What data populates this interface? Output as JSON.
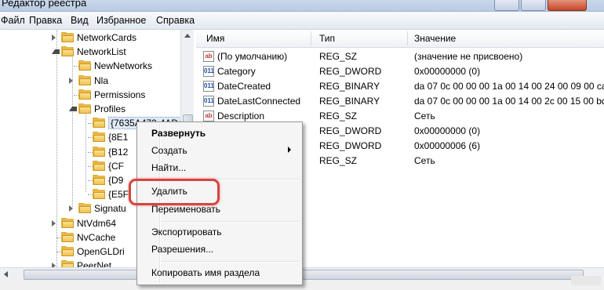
{
  "window": {
    "title": "Редактор реестра"
  },
  "menu": [
    "Файл",
    "Правка",
    "Вид",
    "Избранное",
    "Справка"
  ],
  "tree": [
    {
      "label": "NetworkCards",
      "expander": "closed",
      "depth": 0
    },
    {
      "label": "NetworkList",
      "expander": "open",
      "depth": 0
    },
    {
      "label": "NewNetworks",
      "expander": "none",
      "depth": 1
    },
    {
      "label": "Nla",
      "expander": "closed",
      "depth": 1
    },
    {
      "label": "Permissions",
      "expander": "none",
      "depth": 1
    },
    {
      "label": "Profiles",
      "expander": "open",
      "depth": 1
    },
    {
      "label": "{7635A472-4AD4",
      "expander": "none",
      "depth": 2,
      "selected": true
    },
    {
      "label": "{8E1",
      "expander": "none",
      "depth": 2
    },
    {
      "label": "{B12",
      "expander": "none",
      "depth": 2
    },
    {
      "label": "{CF",
      "expander": "none",
      "depth": 2
    },
    {
      "label": "{D9",
      "expander": "none",
      "depth": 2
    },
    {
      "label": "{E5F",
      "expander": "none",
      "depth": 2
    },
    {
      "label": "Signatu",
      "expander": "closed",
      "depth": 1
    },
    {
      "label": "NtVdm64",
      "expander": "closed",
      "depth": 0
    },
    {
      "label": "NvCache",
      "expander": "none",
      "depth": 0
    },
    {
      "label": "OpenGLDri",
      "expander": "none",
      "depth": 0
    },
    {
      "label": "PeerNet",
      "expander": "closed",
      "depth": 0
    }
  ],
  "list": {
    "columns": [
      "Имя",
      "Тип",
      "Значение"
    ],
    "rows": [
      {
        "icon": "string-value-icon",
        "name": "(По умолчанию)",
        "type": "REG_SZ",
        "data": "(значение не присвоено)"
      },
      {
        "icon": "binary-value-icon",
        "name": "Category",
        "type": "REG_DWORD",
        "data": "0x00000000 (0)"
      },
      {
        "icon": "binary-value-icon",
        "name": "DateCreated",
        "type": "REG_BINARY",
        "data": "da 07 0c 00 00 00 1a 00 14 00 24 00 09 00 ca 00"
      },
      {
        "icon": "binary-value-icon",
        "name": "DateLastConnected",
        "type": "REG_BINARY",
        "data": "da 07 0c 00 00 00 1a 00 14 00 2c 00 15 00 bd 01"
      },
      {
        "icon": "string-value-icon",
        "name": "Description",
        "type": "REG_SZ",
        "data": "Сеть"
      },
      {
        "icon": "binary-value-icon",
        "name": "",
        "type": "REG_DWORD",
        "data": "0x00000000 (0)"
      },
      {
        "icon": "binary-value-icon",
        "name": "",
        "type": "REG_DWORD",
        "data": "0x00000006 (6)"
      },
      {
        "icon": "string-value-icon",
        "name": "",
        "type": "REG_SZ",
        "data": "Сеть"
      }
    ]
  },
  "context_menu": {
    "items": [
      {
        "label": "Развернуть",
        "bold": true
      },
      {
        "label": "Создать",
        "submenu": true
      },
      {
        "label": "Найти..."
      },
      {
        "label": "Удалить",
        "highlighted": true
      },
      {
        "label": "Переименовать"
      },
      {
        "label": "Экспортировать"
      },
      {
        "label": "Разрешения..."
      },
      {
        "label": "Копировать имя раздела"
      }
    ]
  },
  "colors": {
    "highlight_ring": "#d64541",
    "folder": "#f1c24e",
    "selection": "#dfe9f7"
  }
}
